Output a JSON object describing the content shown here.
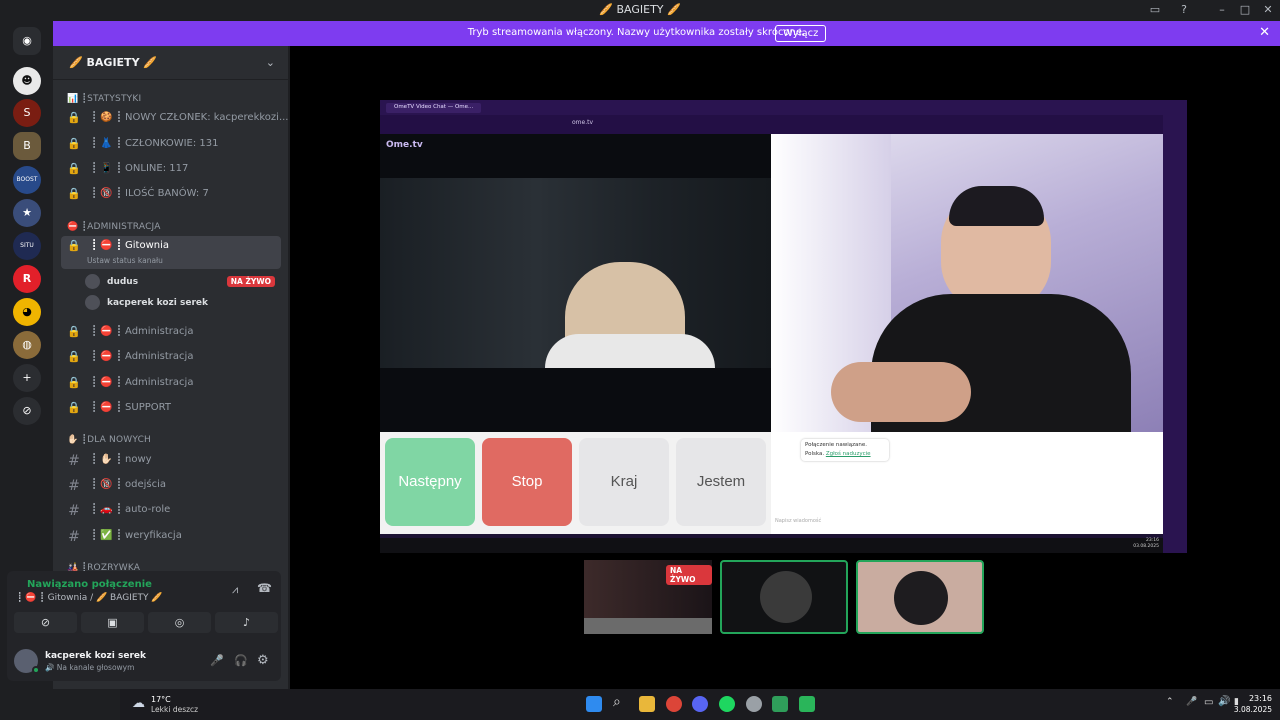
{
  "window": {
    "title": "🥖 BAGIETY 🥖"
  },
  "banner": {
    "message": "Tryb streamowania włączony. Nazwy użytkownika zostały skrócone.",
    "button": "Wyłącz"
  },
  "server": {
    "name": "🥖 BAGIETY 🥖"
  },
  "categories": {
    "stats": "📊 ┋STATYSTYKI",
    "admin": "⛔ ┋ADMINISTRACJA",
    "newbies": "✋🏻 ┋DLA NOWYCH",
    "fun": "🎎 ┋ROZRYWKA"
  },
  "stats_channels": [
    "┋ 🍪 ┋ NOWY CZŁONEK: kacperekkozi...",
    "┋ 👗 ┋ CZŁONKOWIE: 131",
    "┋ 📱 ┋ ONLINE: 117",
    "┋ 🔞 ┋ ILOŚĆ BANÓW: 7"
  ],
  "active_channel": {
    "label": "┋ ⛔ ┋ Gitownia",
    "status_hint": "Ustaw status kanału"
  },
  "voice_users": [
    {
      "name": "dudus",
      "badge": "NA ŻYWO"
    },
    {
      "name": "kacperek kozi serek",
      "badge": ""
    }
  ],
  "admin_channels": [
    "┋ ⛔ ┋ Administracja",
    "┋ ⛔ ┋ Administracja",
    "┋ ⛔ ┋ Administracja",
    "┋ ⛔ ┋ SUPPORT"
  ],
  "new_channels": [
    "┋ ✋🏻 ┋ nowy",
    "┋ 🔞 ┋ odejścia",
    "┋ 🚗 ┋ auto-role",
    "┋ ✅ ┋ weryfikacja"
  ],
  "voice_panel": {
    "status": "Nawiązano połączenie",
    "channel": "┋ ⛔ ┋ Gitownia / 🥖 BAGIETY 🥖"
  },
  "user": {
    "name": "kacperek kozi serek",
    "status": "🔊 Na kanale głosowym"
  },
  "stream": {
    "tab_title": "OmeTV Video Chat — Ome...",
    "url": "ome.tv",
    "logo": "Ome.tv",
    "buttons": {
      "next": "Następny",
      "stop": "Stop",
      "country": "Kraj",
      "gender": "Jestem"
    },
    "chat_connected": "Połączenie nawiązane.",
    "chat_country": "Polska.",
    "chat_link": "Zgłoś naduzycie",
    "chat_placeholder": "Napisz wiadomość",
    "clock_time": "23:16",
    "clock_date": "03.08.2025"
  },
  "tiles": {
    "live_badge": "NA ŻYWO"
  },
  "weather": {
    "temp": "17°C",
    "desc": "Lekki deszcz"
  },
  "clock": {
    "time": "23:16",
    "date": "3.08.2025"
  },
  "colors": {
    "accent": "#7e3cf0",
    "live": "#da373c",
    "online": "#23a55a",
    "next": "#7fd8a2",
    "stop": "#e26b64"
  }
}
